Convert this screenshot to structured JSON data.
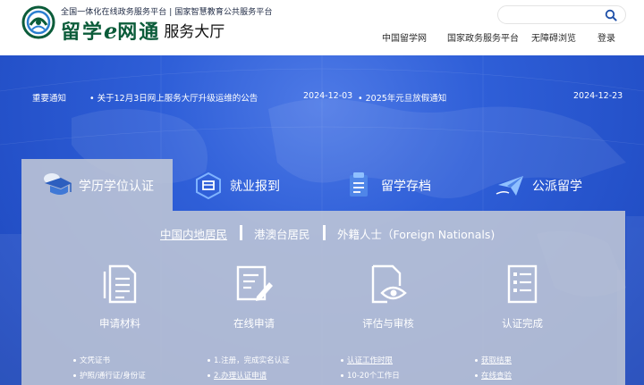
{
  "header": {
    "tagline": "全国一体化在线政务服务平台 | 国家智慧教育公共服务平台",
    "brand_main_a": "留学",
    "brand_e": "e",
    "brand_main_b": "网通",
    "brand_sub": "服务大厅",
    "search": {
      "placeholder": ""
    },
    "nav": [
      "中国留学网",
      "国家政务服务平台",
      "无障碍浏览",
      "登录"
    ]
  },
  "notice": {
    "label": "重要通知",
    "items": [
      {
        "title": "• 关于12月3日网上服务大厅升级运维的公告",
        "date": "2024-12-03"
      },
      {
        "title": "• 2025年元旦放假通知",
        "date": "2024-12-23"
      }
    ]
  },
  "tabs": [
    {
      "label": "学历学位认证",
      "icon": "graduation-cap-icon",
      "active": true
    },
    {
      "label": "就业报到",
      "icon": "briefcase-icon",
      "active": false
    },
    {
      "label": "留学存档",
      "icon": "archive-icon",
      "active": false
    },
    {
      "label": "公派留学",
      "icon": "airplane-icon",
      "active": false
    }
  ],
  "subtabs": [
    "中国内地居民",
    "港澳台居民",
    "外籍人士（Foreign Nationals)"
  ],
  "steps": [
    {
      "label": "申请材料",
      "icon": "documents-icon"
    },
    {
      "label": "在线申请",
      "icon": "edit-form-icon"
    },
    {
      "label": "评估与审核",
      "icon": "document-eye-icon"
    },
    {
      "label": "认证完成",
      "icon": "checklist-icon"
    }
  ],
  "details": [
    [
      "文凭证书",
      "护照/通行证/身份证"
    ],
    [
      "1.注册，完成实名认证",
      "2.办理认证申请"
    ],
    [
      "认证工作时限",
      "10-20个工作日"
    ],
    [
      "获取结果",
      "在线查验"
    ]
  ],
  "colors": {
    "brand_green": "#0b5c3a",
    "hero_blue": "#2f5fd8",
    "panel_gray": "#c4c9d6"
  }
}
